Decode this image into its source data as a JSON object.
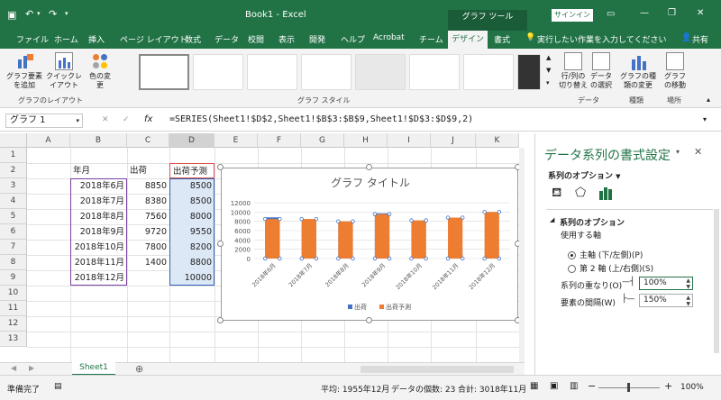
{
  "titlebar": {
    "title": "Book1 - Excel",
    "context": "グラフ ツール",
    "signin": "サインイン"
  },
  "tabs": [
    {
      "label": "ファイル"
    },
    {
      "label": "ホーム"
    },
    {
      "label": "挿入"
    },
    {
      "label": "ページ レイアウト"
    },
    {
      "label": "数式"
    },
    {
      "label": "データ"
    },
    {
      "label": "校閲"
    },
    {
      "label": "表示"
    },
    {
      "label": "開発"
    },
    {
      "label": "ヘルプ"
    },
    {
      "label": "Acrobat"
    },
    {
      "label": "チーム"
    },
    {
      "label": "デザイン"
    },
    {
      "label": "書式"
    }
  ],
  "tellme": "実行したい作業を入力してください",
  "share": "共有",
  "ribbon": {
    "add_element": "グラフ要素を追加",
    "quick_layout": "クイックレイアウト",
    "change_color": "色の変更",
    "layouts_group": "グラフのレイアウト",
    "styles_group": "グラフ スタイル",
    "switch_rowcol": "行/列の切り替え",
    "select_data": "データの選択",
    "data_group": "データ",
    "change_type": "グラフの種類の変更",
    "type_group": "種類",
    "move_chart": "グラフの移動",
    "location_group": "場所"
  },
  "formula": {
    "namebox": "グラフ 1",
    "cancel": "✕",
    "enter": "✓",
    "fx": "fx",
    "text": "=SERIES(Sheet1!$D$2,Sheet1!$B$3:$B$9,Sheet1!$D$3:$D$9,2)"
  },
  "columns": [
    "A",
    "B",
    "C",
    "D",
    "E",
    "F",
    "G",
    "H",
    "I",
    "J",
    "K"
  ],
  "rows": [
    "1",
    "2",
    "3",
    "4",
    "5",
    "6",
    "7",
    "8",
    "9",
    "10",
    "11",
    "12",
    "13"
  ],
  "table": {
    "headers": [
      "年月",
      "出荷",
      "出荷予測"
    ],
    "rows": [
      [
        "2018年6月",
        "8850",
        "8500"
      ],
      [
        "2018年7月",
        "8380",
        "8500"
      ],
      [
        "2018年8月",
        "7560",
        "8000"
      ],
      [
        "2018年9月",
        "9720",
        "9550"
      ],
      [
        "2018年10月",
        "7800",
        "8200"
      ],
      [
        "2018年11月",
        "1400",
        "8800"
      ],
      [
        "2018年12月",
        "",
        "10000"
      ]
    ]
  },
  "chart_data": {
    "type": "bar",
    "title": "グラフ タイトル",
    "categories": [
      "2018年6月",
      "2018年7月",
      "2018年8月",
      "2018年9月",
      "2018年10月",
      "2018年11月",
      "2018年12月"
    ],
    "series": [
      {
        "name": "出荷",
        "values": [
          8850,
          8380,
          7560,
          9720,
          7800,
          1400,
          0
        ],
        "color": "#4472c4"
      },
      {
        "name": "出荷予測",
        "values": [
          8500,
          8500,
          8000,
          9550,
          8200,
          8800,
          10000
        ],
        "color": "#ed7d31"
      }
    ],
    "overlap": "100%",
    "yticks": [
      "0",
      "2000",
      "4000",
      "6000",
      "8000",
      "10000",
      "12000"
    ],
    "ylim": [
      0,
      12000
    ]
  },
  "pane": {
    "title": "データ系列の書式設定",
    "options_dropdown": "系列のオプション",
    "section": "系列のオプション",
    "axis_label": "使用する軸",
    "primary_axis": "主軸 (下/左側)(P)",
    "secondary_axis": "第 2 軸 (上/右側)(S)",
    "overlap_label": "系列の重なり(O)",
    "overlap_value": "100%",
    "gap_label": "要素の間隔(W)",
    "gap_value": "150%"
  },
  "sheet_tab": "Sheet1",
  "status": {
    "ready": "準備完了",
    "average": "平均: 1955年12月",
    "count": "データの個数: 23",
    "sum": "合計: 3018年11月",
    "zoom": "100%"
  }
}
